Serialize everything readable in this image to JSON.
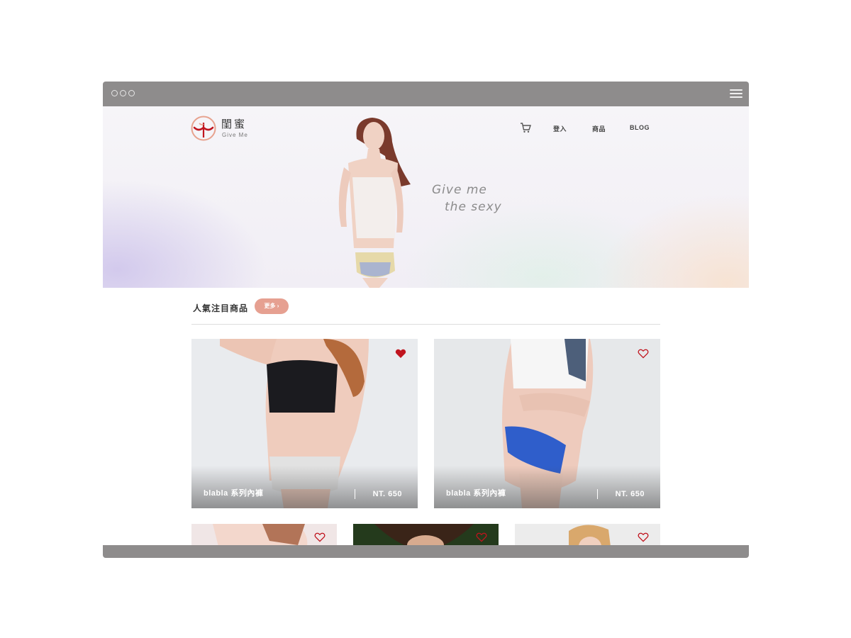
{
  "brand": {
    "name_cn": "閨蜜",
    "name_en": "Give Me"
  },
  "nav": {
    "cart_icon": "shopping-cart-icon",
    "login": "登入",
    "products": "商品",
    "blog": "BLOG"
  },
  "hero": {
    "tagline_line1": "Give me",
    "tagline_line2": "the sexy"
  },
  "section": {
    "title": "人氣注目商品",
    "more_label": "更多 ›"
  },
  "products": [
    {
      "name": "blabla 系列內褲",
      "price": "NT. 650",
      "favorited": true
    },
    {
      "name": "blabla 系列內褲",
      "price": "NT. 650",
      "favorited": false
    }
  ],
  "colors": {
    "accent": "#e6a091",
    "heart": "#c0141e",
    "frame": "#8e8c8c"
  }
}
